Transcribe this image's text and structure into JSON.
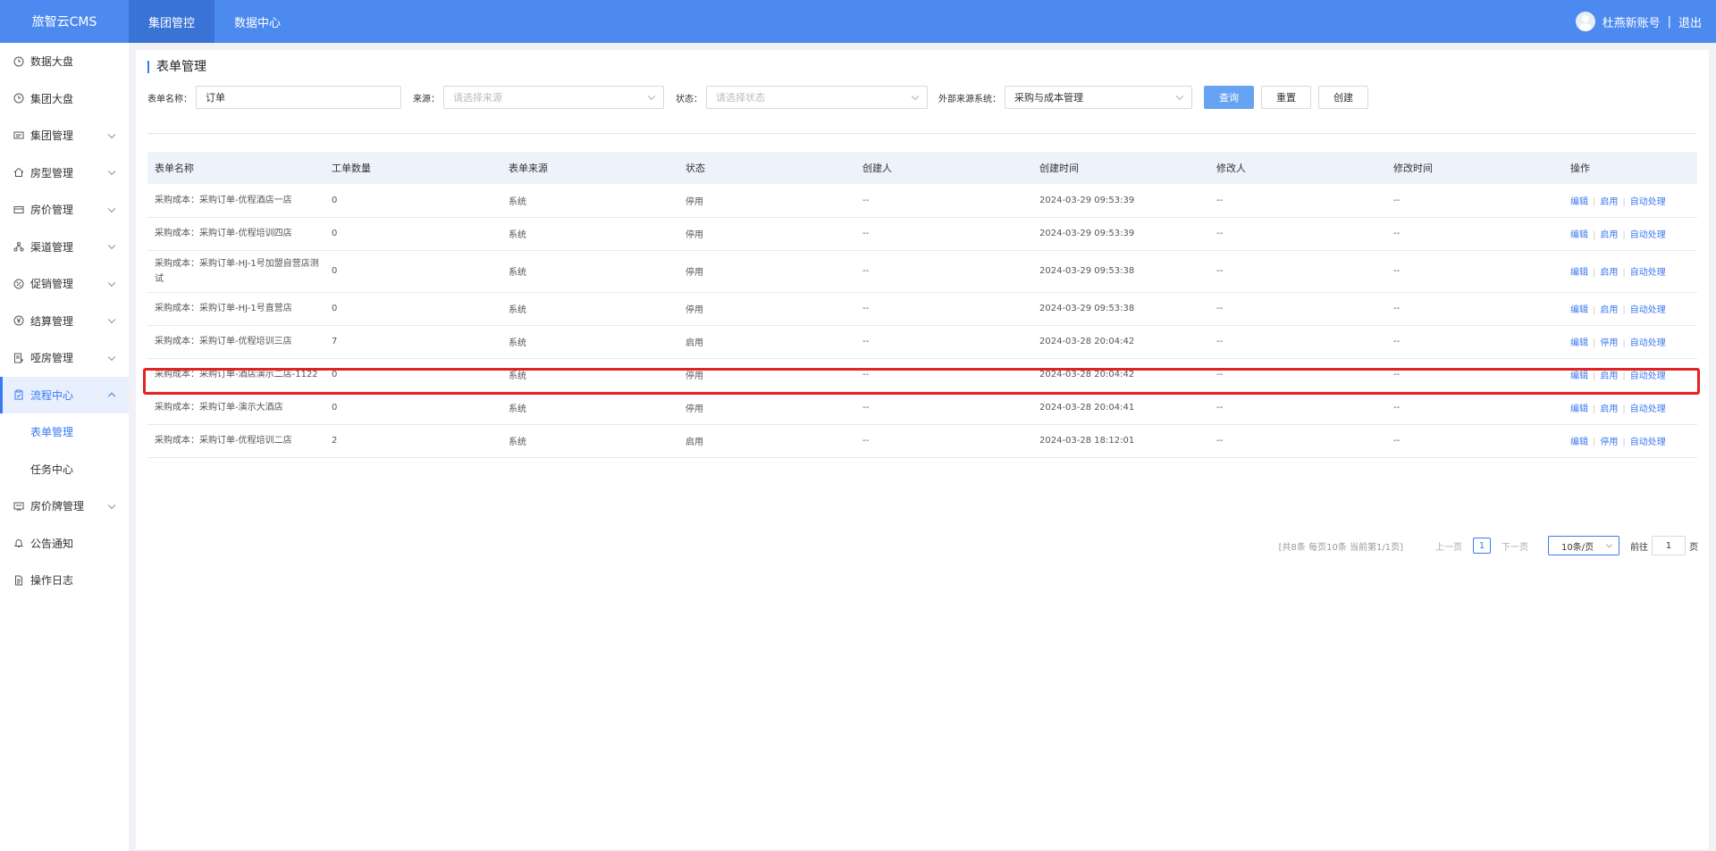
{
  "header": {
    "brand": "旅智云CMS",
    "nav": [
      "集团管控",
      "数据中心"
    ],
    "user": "杜燕新账号",
    "separator": "|",
    "logout": "退出"
  },
  "sidebar": {
    "items": [
      {
        "label": "数据大盘",
        "icon": "clock-icon"
      },
      {
        "label": "集团大盘",
        "icon": "clock-icon"
      },
      {
        "label": "集团管理",
        "icon": "message-icon"
      },
      {
        "label": "房型管理",
        "icon": "home-icon"
      },
      {
        "label": "房价管理",
        "icon": "card-icon"
      },
      {
        "label": "渠道管理",
        "icon": "network-icon"
      },
      {
        "label": "促销管理",
        "icon": "discount-icon"
      },
      {
        "label": "结算管理",
        "icon": "yen-icon"
      },
      {
        "label": "哑房管理",
        "icon": "doc-edit-icon"
      },
      {
        "label": "流程中心",
        "icon": "clipboard-icon"
      },
      {
        "label": "表单管理"
      },
      {
        "label": "任务中心"
      },
      {
        "label": "房价牌管理",
        "icon": "board-icon"
      },
      {
        "label": "公告通知",
        "icon": "bell-icon"
      },
      {
        "label": "操作日志",
        "icon": "file-icon"
      }
    ]
  },
  "page": {
    "title": "表单管理"
  },
  "filters": {
    "name_label": "表单名称：",
    "name_value": "订单",
    "source_label": "来源：",
    "source_placeholder": "请选择来源",
    "status_label": "状态：",
    "status_placeholder": "请选择状态",
    "external_label": "外部来源系统：",
    "external_value": "采购与成本管理",
    "query": "查询",
    "reset": "重置",
    "create": "创建"
  },
  "table": {
    "headers": [
      "表单名称",
      "工单数量",
      "表单来源",
      "状态",
      "创建人",
      "创建时间",
      "修改人",
      "修改时间",
      "操作"
    ],
    "actions": {
      "edit": "编辑",
      "enable": "启用",
      "disable": "停用",
      "auto": "自动处理",
      "sep": "|"
    },
    "rows": [
      {
        "name": "采购成本：采购订单-优程酒店一店",
        "count": "0",
        "source": "系统",
        "status": "停用",
        "creator": "--",
        "created": "2024-03-29 09:53:39",
        "modifier": "--",
        "modified": "--",
        "toggle": "启用"
      },
      {
        "name": "采购成本：采购订单-优程培训四店",
        "count": "0",
        "source": "系统",
        "status": "停用",
        "creator": "--",
        "created": "2024-03-29 09:53:39",
        "modifier": "--",
        "modified": "--",
        "toggle": "启用"
      },
      {
        "name": "采购成本：采购订单-HJ-1号加盟自营店测试",
        "count": "0",
        "source": "系统",
        "status": "停用",
        "creator": "--",
        "created": "2024-03-29 09:53:38",
        "modifier": "--",
        "modified": "--",
        "toggle": "启用"
      },
      {
        "name": "采购成本：采购订单-HJ-1号直营店",
        "count": "0",
        "source": "系统",
        "status": "停用",
        "creator": "--",
        "created": "2024-03-29 09:53:38",
        "modifier": "--",
        "modified": "--",
        "toggle": "启用"
      },
      {
        "name": "采购成本：采购订单-优程培训三店",
        "count": "7",
        "source": "系统",
        "status": "启用",
        "creator": "--",
        "created": "2024-03-28 20:04:42",
        "modifier": "--",
        "modified": "--",
        "toggle": "停用"
      },
      {
        "name": "采购成本：采购订单-酒店演示二店-1122",
        "count": "0",
        "source": "系统",
        "status": "停用",
        "creator": "--",
        "created": "2024-03-28 20:04:42",
        "modifier": "--",
        "modified": "--",
        "toggle": "启用"
      },
      {
        "name": "采购成本：采购订单-演示大酒店",
        "count": "0",
        "source": "系统",
        "status": "停用",
        "creator": "--",
        "created": "2024-03-28 20:04:41",
        "modifier": "--",
        "modified": "--",
        "toggle": "启用"
      },
      {
        "name": "采购成本：采购订单-优程培训二店",
        "count": "2",
        "source": "系统",
        "status": "启用",
        "creator": "--",
        "created": "2024-03-28 18:12:01",
        "modifier": "--",
        "modified": "--",
        "toggle": "停用"
      }
    ]
  },
  "pagination": {
    "info": "[共8条 每页10条 当前第1/1页]",
    "prev": "上一页",
    "current": "1",
    "next": "下一页",
    "page_size": "10条/页",
    "goto_label": "前往",
    "goto_value": "1",
    "page_unit": "页"
  },
  "colors": {
    "topbar": "#4d8af0",
    "accent": "#3a7af0",
    "highlight": "#e52222"
  }
}
